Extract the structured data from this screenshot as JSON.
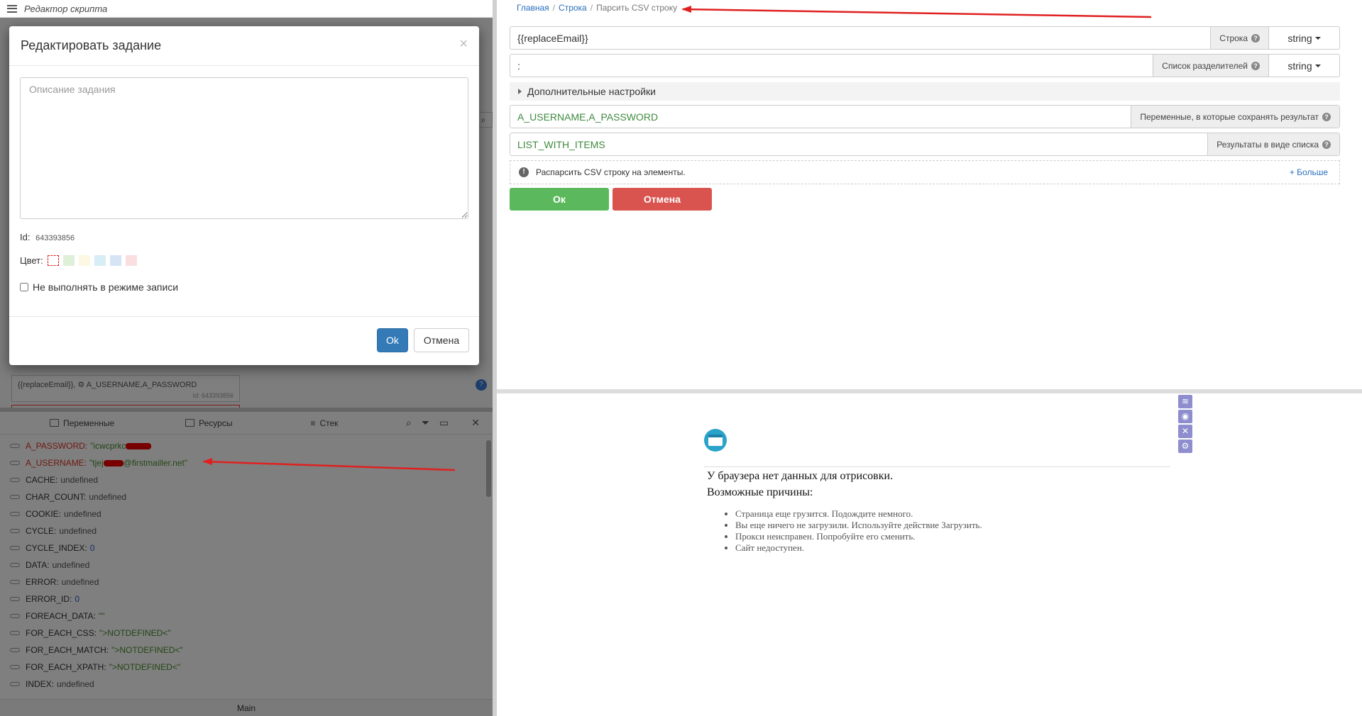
{
  "left": {
    "title": "Редактор скрипта",
    "ghost_block": {
      "text": "{{replaceEmail}}, ⚙ A_USERNAME,A_PASSWORD",
      "sub": "Id: 643393856"
    },
    "modal": {
      "title": "Редактировать задание",
      "close": "×",
      "textarea_placeholder": "Описание задания",
      "id_label": "Id:",
      "id_value": "643393856",
      "color_label": "Цвет:",
      "colors": [
        "#dff0d8",
        "#fcf8e3",
        "#d9edf7",
        "#d6e4f5",
        "#f9dfe0"
      ],
      "checkbox_label": "Не выполнять в режиме записи",
      "ok": "Ok",
      "cancel": "Отмена"
    },
    "vars_tabs": {
      "variables": "Переменные",
      "resources": "Ресурсы",
      "stack": "Стек"
    },
    "variables": [
      {
        "name": "A_PASSWORD:",
        "value": "\"icwcprkc",
        "type": "str",
        "red": true,
        "redact": 36
      },
      {
        "name": "A_USERNAME:",
        "value": "\"tjej",
        "value_end": "@firstmailler.net\"",
        "type": "str",
        "red": true,
        "redact": 28
      },
      {
        "name": "CACHE:",
        "value": "undefined",
        "type": "plain"
      },
      {
        "name": "CHAR_COUNT:",
        "value": "undefined",
        "type": "plain"
      },
      {
        "name": "COOKIE:",
        "value": "undefined",
        "type": "plain"
      },
      {
        "name": "CYCLE:",
        "value": "undefined",
        "type": "plain"
      },
      {
        "name": "CYCLE_INDEX:",
        "value": "0",
        "type": "num"
      },
      {
        "name": "DATA:",
        "value": "undefined",
        "type": "plain"
      },
      {
        "name": "ERROR:",
        "value": "undefined",
        "type": "plain"
      },
      {
        "name": "ERROR_ID:",
        "value": "0",
        "type": "num"
      },
      {
        "name": "FOREACH_DATA:",
        "value": "\"\"",
        "type": "str"
      },
      {
        "name": "FOR_EACH_CSS:",
        "value": "\">NOTDEFINED<\"",
        "type": "tag"
      },
      {
        "name": "FOR_EACH_MATCH:",
        "value": "\">NOTDEFINED<\"",
        "type": "tag"
      },
      {
        "name": "FOR_EACH_XPATH:",
        "value": "\">NOTDEFINED<\"",
        "type": "tag"
      },
      {
        "name": "INDEX:",
        "value": "undefined",
        "type": "plain"
      }
    ],
    "bottom_tab": "Main"
  },
  "right": {
    "breadcrumb": [
      "Главная",
      "Строка",
      "Парсить CSV строку"
    ],
    "fields": [
      {
        "value": "{{replaceEmail}}",
        "label": "Строка",
        "select": "string"
      },
      {
        "value": ":",
        "label": "Список разделителей",
        "select": "string"
      },
      {
        "value": "A_USERNAME,A_PASSWORD",
        "label": "Переменные, в которые сохранять результат"
      },
      {
        "value": "LIST_WITH_ITEMS",
        "label": "Результаты в виде списка"
      }
    ],
    "extra_settings": "Дополнительные настройки",
    "info_text": "Распарсить CSV строку на элементы.",
    "more": "+ Больше",
    "ok": "Ок",
    "cancel": "Отмена",
    "browser": {
      "message": "У браузера нет данных для отрисовки.",
      "reasons_title": "Возможные причины:",
      "reasons": [
        "Страница еще грузится. Подождите немного.",
        "Вы еще ничего не загрузили. Используйте действие Загрузить.",
        "Прокси неисправен. Попробуйте его сменить.",
        "Сайт недоступен."
      ],
      "side_icons": [
        "wifi-icon",
        "record-icon",
        "crosshair-icon",
        "gear-icon"
      ]
    }
  },
  "annotation_color": "#e02020"
}
